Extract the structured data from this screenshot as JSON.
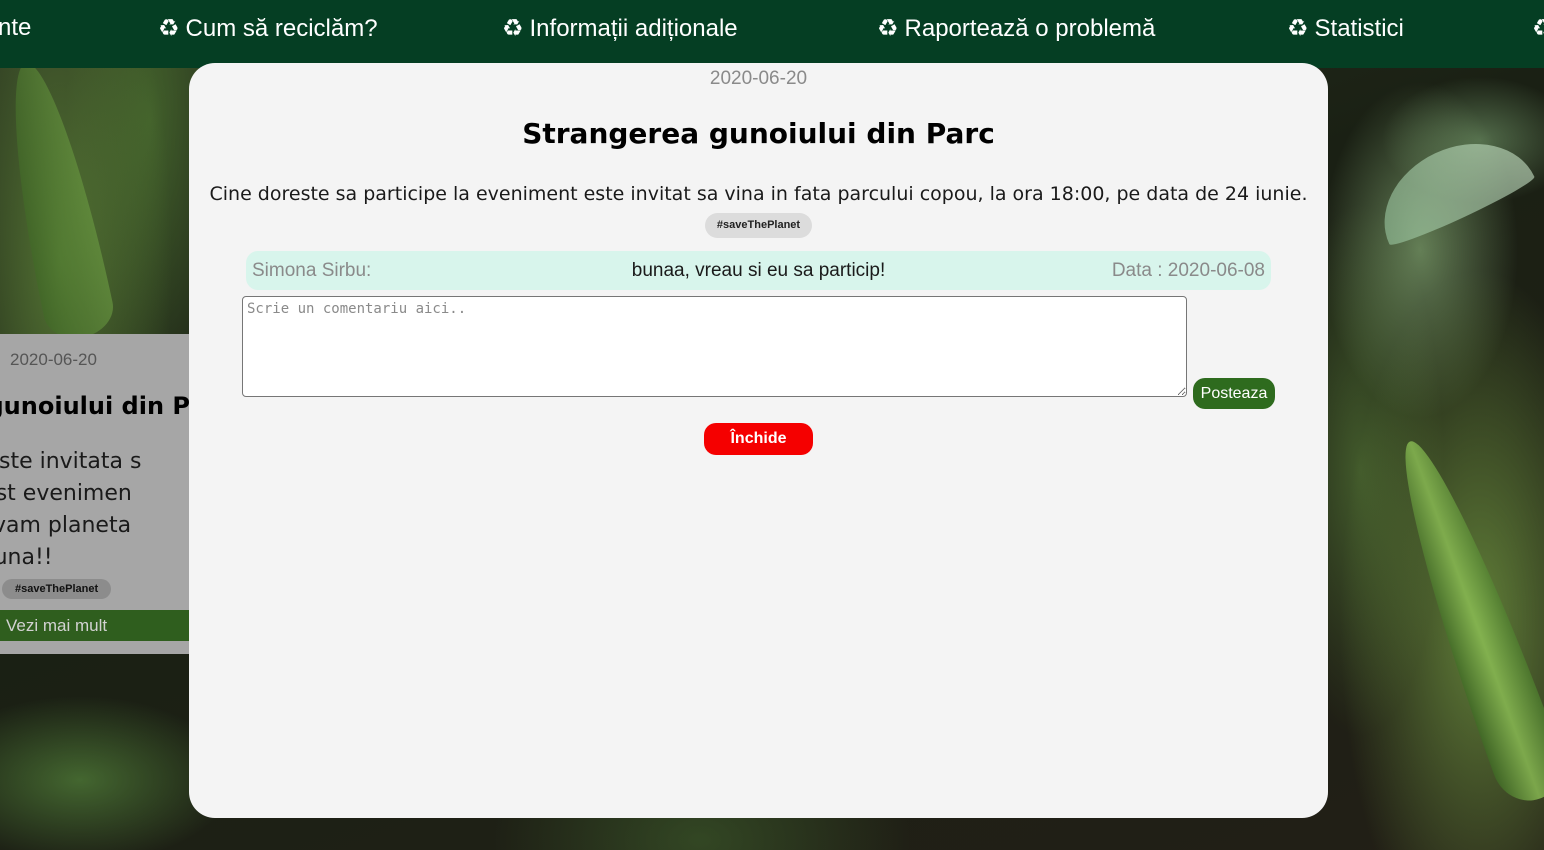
{
  "nav": {
    "items": [
      {
        "label": "nte",
        "icon": "recycle-icon"
      },
      {
        "label": "Cum să reciclăm?",
        "icon": "recycle-icon"
      },
      {
        "label": "Informații adiționale",
        "icon": "recycle-icon"
      },
      {
        "label": "Raportează o problemă",
        "icon": "recycle-icon"
      },
      {
        "label": "Statistici",
        "icon": "recycle-icon"
      }
    ],
    "background_color": "#053e23"
  },
  "background_card": {
    "date": "2020-06-20",
    "title": "a gunoiului din P",
    "description_lines": [
      "mea este invitata s",
      " la acest evenimen",
      " sa salvam planeta",
      "impreuna!!"
    ],
    "tag": "#saveThePlanet",
    "more_label": "Vezi mai mult"
  },
  "modal": {
    "date": "2020-06-20",
    "title": "Strangerea gunoiului din Parc",
    "description": "Cine doreste sa participe la eveniment este invitat sa vina in fata parcului copou, la ora 18:00, pe data de 24 iunie.",
    "tag": "#saveThePlanet",
    "comments": [
      {
        "author": "Simona Sirbu:",
        "text": "bunaa, vreau si eu sa particip!",
        "date": "Data : 2020-06-08"
      }
    ],
    "comment_input": {
      "placeholder": "Scrie un comentariu aici..",
      "value": ""
    },
    "post_label": "Posteaza",
    "close_label": "Închide",
    "colors": {
      "post_button": "#2e6b1e",
      "close_button": "#f50000",
      "comment_bg": "#d8f5ec"
    }
  }
}
